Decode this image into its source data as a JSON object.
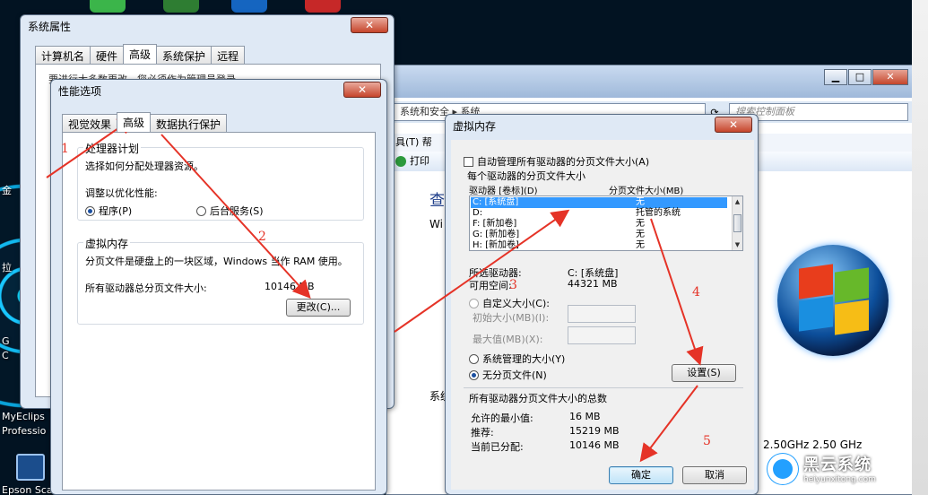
{
  "desktop": {
    "icons": [
      "金",
      "拉",
      "G",
      "C",
      "MyEclips",
      "Professio",
      "Epson Sca"
    ]
  },
  "explorer": {
    "address": "系统和安全 ▸ 系统",
    "search_placeholder": "搜索控制面板",
    "menu_fragment": "具(T)  帮",
    "print_label": "打印",
    "heading_fragment": "查",
    "w_fragment": "Wi",
    "system_fragment": "系统",
    "cpu_speed": "2.50GHz  2.50 GHz"
  },
  "system_props": {
    "title": "系统属性",
    "tabs": [
      "计算机名",
      "硬件",
      "高级",
      "系统保护",
      "远程"
    ],
    "active_tab": 2,
    "hidden_text": "要进行大多数更改，您必须作为管理员登录。"
  },
  "perf_options": {
    "title": "性能选项",
    "tabs": [
      "视觉效果",
      "高级",
      "数据执行保护"
    ],
    "active_tab": 1,
    "processor": {
      "title": "处理器计划",
      "desc": "选择如何分配处理器资源。",
      "adjust": "调整以优化性能:",
      "opt_program": "程序(P)",
      "opt_service": "后台服务(S)"
    },
    "virtual_memory": {
      "title": "虚拟内存",
      "desc": "分页文件是硬盘上的一块区域，Windows 当作 RAM 使用。",
      "total_label": "所有驱动器总分页文件大小:",
      "total_value": "10146 MB",
      "change_button": "更改(C)..."
    }
  },
  "vm_dialog": {
    "title": "虚拟内存",
    "auto_manage": "自动管理所有驱动器的分页文件大小(A)",
    "per_drive_label": "每个驱动器的分页文件大小",
    "col_drive": "驱动器 [卷标](D)",
    "col_size": "分页文件大小(MB)",
    "drives": [
      {
        "drive": "C:   [系统盘]",
        "size": "无"
      },
      {
        "drive": "D:",
        "size": "托管的系统"
      },
      {
        "drive": "F:   [新加卷]",
        "size": "无"
      },
      {
        "drive": "G:   [新加卷]",
        "size": "无"
      },
      {
        "drive": "H:   [新加卷]",
        "size": "无"
      }
    ],
    "selected_drive_label": "所选驱动器:",
    "selected_drive_value": "C:  [系统盘]",
    "free_space_label": "可用空间:",
    "free_space_value": "44321 MB",
    "custom_size": "自定义大小(C):",
    "initial_size": "初始大小(MB)(I):",
    "max_size": "最大值(MB)(X):",
    "system_managed": "系统管理的大小(Y)",
    "no_paging": "无分页文件(N)",
    "set_button": "设置(S)",
    "totals_label": "所有驱动器分页文件大小的总数",
    "min_allowed_label": "允许的最小值:",
    "min_allowed_value": "16 MB",
    "recommended_label": "推荐:",
    "recommended_value": "15219 MB",
    "current_label": "当前已分配:",
    "current_value": "10146 MB",
    "ok_button": "确定",
    "cancel_button": "取消"
  },
  "annotations": {
    "step_numbers": [
      "1",
      "2",
      "3",
      "4",
      "5"
    ],
    "color": "#e53327"
  },
  "watermark": {
    "name": "黑云系统",
    "url": "heiyunxitong.com"
  }
}
